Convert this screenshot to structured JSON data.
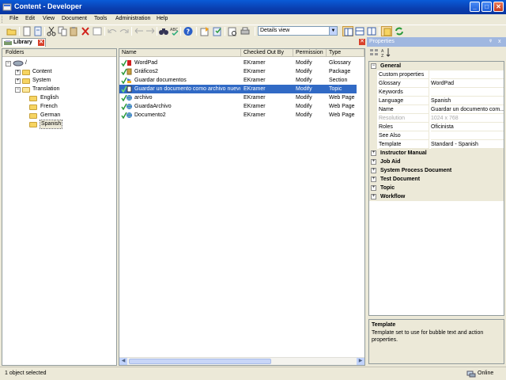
{
  "window": {
    "title": "Content - Developer"
  },
  "menu": [
    "File",
    "Edit",
    "View",
    "Document",
    "Tools",
    "Administration",
    "Help"
  ],
  "toolbar": {
    "view_selected": "Details view"
  },
  "library": {
    "tab_label": "Library",
    "close_symbol": "✕"
  },
  "folders": {
    "header": "Folders",
    "nodes": [
      {
        "label": "/",
        "level": 0
      },
      {
        "label": "Content",
        "level": 1
      },
      {
        "label": "System",
        "level": 1
      },
      {
        "label": "Translation",
        "level": 1
      },
      {
        "label": "English",
        "level": 2
      },
      {
        "label": "French",
        "level": 2
      },
      {
        "label": "German",
        "level": 2
      },
      {
        "label": "Spanish",
        "level": 2,
        "selected": true
      }
    ]
  },
  "doclist": {
    "columns": [
      "Name",
      "Checked Out By",
      "Permission",
      "Type"
    ],
    "rows": [
      {
        "name": "WordPad",
        "checked_out_by": "EKramer",
        "permission": "Modify",
        "type": "Glossary",
        "icon": "glossary-icon"
      },
      {
        "name": "Gráficos2",
        "checked_out_by": "EKramer",
        "permission": "Modify",
        "type": "Package",
        "icon": "package-icon"
      },
      {
        "name": "Guardar documentos",
        "checked_out_by": "EKramer",
        "permission": "Modify",
        "type": "Section",
        "icon": "section-icon"
      },
      {
        "name": "Guardar un documento como archivo nuevo",
        "checked_out_by": "EKramer",
        "permission": "Modify",
        "type": "Topic",
        "icon": "topic-icon",
        "selected": true
      },
      {
        "name": "archivo",
        "checked_out_by": "EKramer",
        "permission": "Modify",
        "type": "Web Page",
        "icon": "web-page-icon"
      },
      {
        "name": "GuardaArchivo",
        "checked_out_by": "EKramer",
        "permission": "Modify",
        "type": "Web Page",
        "icon": "web-page-icon"
      },
      {
        "name": "Documento2",
        "checked_out_by": "EKramer",
        "permission": "Modify",
        "type": "Web Page",
        "icon": "web-page-icon"
      }
    ]
  },
  "properties": {
    "title": "Properties",
    "pin_symbol": "ᵠ",
    "close_symbol": "x",
    "general_label": "General",
    "rows": [
      {
        "name": "Custom properties",
        "value": ""
      },
      {
        "name": "Glossary",
        "value": "WordPad"
      },
      {
        "name": "Keywords",
        "value": ""
      },
      {
        "name": "Language",
        "value": "Spanish"
      },
      {
        "name": "Name",
        "value": "Guardar un documento com..."
      },
      {
        "name": "Resolution",
        "value": "1024 x 768",
        "disabled": true
      },
      {
        "name": "Roles",
        "value": "Oficinista"
      },
      {
        "name": "See Also",
        "value": ""
      },
      {
        "name": "Template",
        "value": "Standard - Spanish"
      }
    ],
    "categories": [
      "Instructor Manual",
      "Job Aid",
      "System Process Document",
      "Test Document",
      "Topic",
      "Workflow"
    ],
    "description": {
      "title": "Template",
      "text": "Template set to use for bubble text and action properties."
    }
  },
  "status": {
    "left": "1 object selected",
    "right": "Online"
  }
}
